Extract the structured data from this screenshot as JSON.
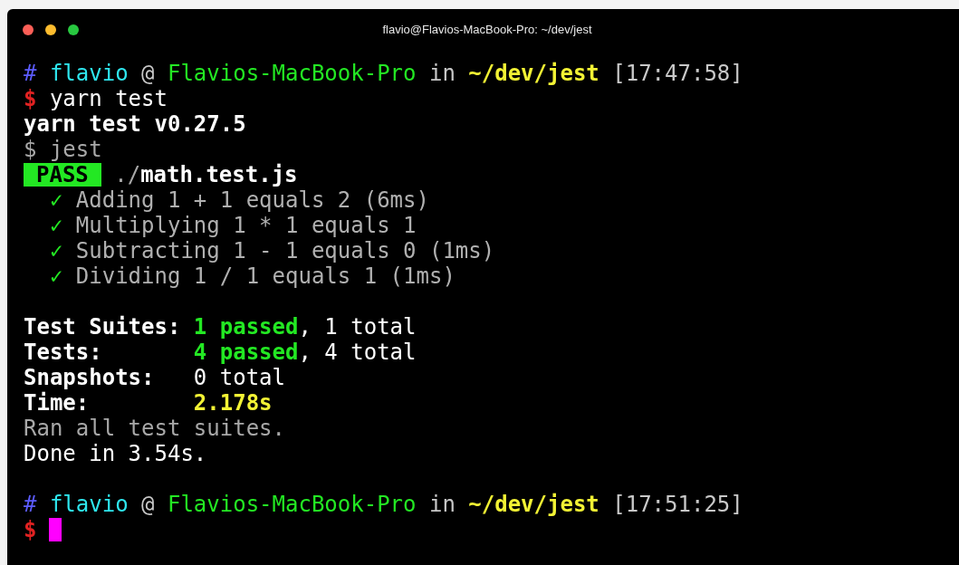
{
  "window": {
    "title": "flavio@Flavios-MacBook-Pro: ~/dev/jest"
  },
  "blocks": [
    {
      "lines": [
        {
          "segments": [
            {
              "kind": "text",
              "text": "#",
              "color": "#5c5cff",
              "bold": false
            },
            {
              "kind": "text",
              "text": " flavio",
              "color": "#2ee6ee",
              "bold": false
            },
            {
              "kind": "text",
              "text": " @ ",
              "color": "#c8c8c8",
              "bold": false
            },
            {
              "kind": "text",
              "text": "Flavios-MacBook-Pro",
              "color": "#23e823",
              "bold": false
            },
            {
              "kind": "text",
              "text": " in ",
              "color": "#c8c8c8",
              "bold": false
            },
            {
              "kind": "text",
              "text": "~/dev/jest",
              "color": "#f2f234",
              "bold": true
            },
            {
              "kind": "text",
              "text": " [17:47:58]",
              "color": "#c8c8c8",
              "bold": false
            }
          ]
        },
        {
          "segments": [
            {
              "kind": "text",
              "text": "$",
              "color": "#e22222",
              "bold": true
            },
            {
              "kind": "text",
              "text": " yarn test",
              "color": "#ffffff",
              "bold": false
            }
          ]
        },
        {
          "segments": [
            {
              "kind": "text",
              "text": "yarn test v0.27.5",
              "color": "#ffffff",
              "bold": true
            }
          ]
        },
        {
          "segments": [
            {
              "kind": "text",
              "text": "$ jest",
              "color": "#a8a8a8",
              "bold": false
            }
          ]
        },
        {
          "segments": [
            {
              "kind": "badge",
              "text": "PASS",
              "color": "#23e823",
              "bold": true
            },
            {
              "kind": "text",
              "text": " ./",
              "color": "#a8a8a8",
              "bold": false
            },
            {
              "kind": "text",
              "text": "math.test.js",
              "color": "#ffffff",
              "bold": true
            }
          ]
        },
        {
          "segments": [
            {
              "kind": "text",
              "text": "  ✓",
              "color": "#23e823"
            },
            {
              "kind": "text",
              "text": " Adding 1 + 1 equals 2 (6ms)",
              "color": "#b0b0b0",
              "bold": false
            }
          ]
        },
        {
          "segments": [
            {
              "kind": "text",
              "text": "  ✓",
              "color": "#23e823"
            },
            {
              "kind": "text",
              "text": " Multiplying 1 * 1 equals 1",
              "color": "#b0b0b0",
              "bold": false
            }
          ]
        },
        {
          "segments": [
            {
              "kind": "text",
              "text": "  ✓",
              "color": "#23e823"
            },
            {
              "kind": "text",
              "text": " Subtracting 1 - 1 equals 0 (1ms)",
              "color": "#b0b0b0",
              "bold": false
            }
          ]
        },
        {
          "segments": [
            {
              "kind": "text",
              "text": "  ✓",
              "color": "#23e823"
            },
            {
              "kind": "text",
              "text": " Dividing 1 / 1 equals 1 (1ms)",
              "color": "#b0b0b0",
              "bold": false
            }
          ]
        }
      ]
    },
    {
      "lines": [
        {
          "segments": [
            {
              "kind": "text",
              "text": "Test Suites: ",
              "color": "#ffffff",
              "bold": true
            },
            {
              "kind": "text",
              "text": "1 passed",
              "color": "#23e823",
              "bold": true
            },
            {
              "kind": "text",
              "text": ", 1 total",
              "color": "#ffffff",
              "bold": false
            }
          ]
        },
        {
          "segments": [
            {
              "kind": "text",
              "text": "Tests:       ",
              "color": "#ffffff",
              "bold": true
            },
            {
              "kind": "text",
              "text": "4 passed",
              "color": "#23e823",
              "bold": true
            },
            {
              "kind": "text",
              "text": ", 4 total",
              "color": "#ffffff",
              "bold": false
            }
          ]
        },
        {
          "segments": [
            {
              "kind": "text",
              "text": "Snapshots:   ",
              "color": "#ffffff",
              "bold": true
            },
            {
              "kind": "text",
              "text": "0 total",
              "color": "#ffffff",
              "bold": false
            }
          ]
        },
        {
          "segments": [
            {
              "kind": "text",
              "text": "Time:        ",
              "color": "#ffffff",
              "bold": true
            },
            {
              "kind": "text",
              "text": "2.178s",
              "color": "#f2f234",
              "bold": true
            }
          ]
        },
        {
          "segments": [
            {
              "kind": "text",
              "text": "Ran all test suites.",
              "color": "#a8a8a8",
              "bold": false
            }
          ]
        },
        {
          "segments": [
            {
              "kind": "text",
              "text": "Done in 3.54s.",
              "color": "#ffffff",
              "bold": false
            }
          ]
        }
      ]
    },
    {
      "lines": [
        {
          "segments": [
            {
              "kind": "text",
              "text": "#",
              "color": "#5c5cff",
              "bold": false
            },
            {
              "kind": "text",
              "text": " flavio",
              "color": "#2ee6ee",
              "bold": false
            },
            {
              "kind": "text",
              "text": " @ ",
              "color": "#c8c8c8",
              "bold": false
            },
            {
              "kind": "text",
              "text": "Flavios-MacBook-Pro",
              "color": "#23e823",
              "bold": false
            },
            {
              "kind": "text",
              "text": " in ",
              "color": "#c8c8c8",
              "bold": false
            },
            {
              "kind": "text",
              "text": "~/dev/jest",
              "color": "#f2f234",
              "bold": true
            },
            {
              "kind": "text",
              "text": " [17:51:25]",
              "color": "#c8c8c8",
              "bold": false
            }
          ]
        },
        {
          "segments": [
            {
              "kind": "text",
              "text": "$",
              "color": "#e22222",
              "bold": true
            }
          ],
          "cursor": true
        }
      ]
    }
  ]
}
